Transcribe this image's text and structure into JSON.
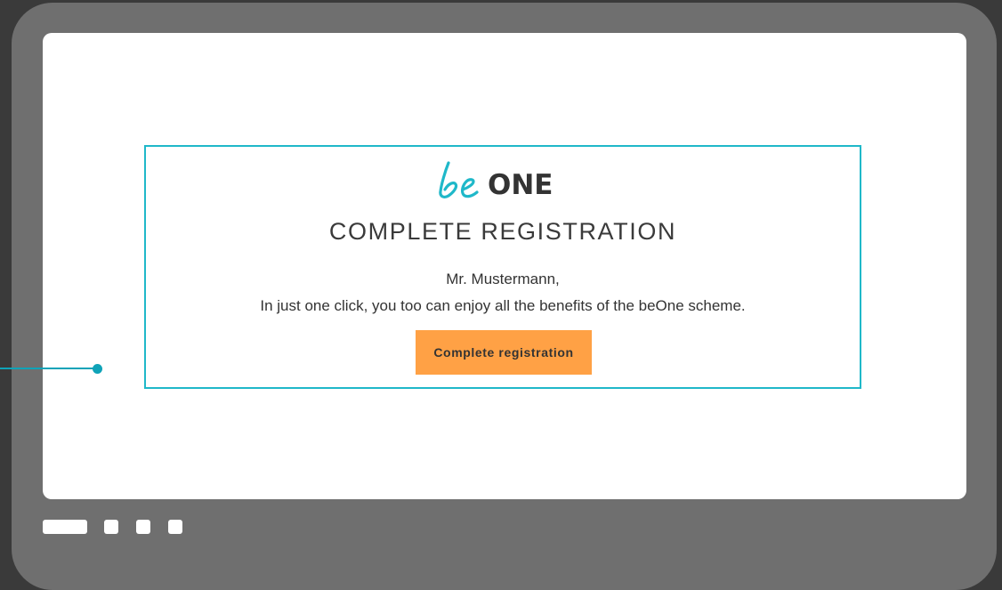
{
  "brand": {
    "logo_script": "be",
    "logo_word": "ONE",
    "accent_color": "#1fb8c9",
    "button_color": "#ffa145",
    "callout_color": "#0fa3b8"
  },
  "email": {
    "title": "COMPLETE REGISTRATION",
    "salutation": "Mr. Mustermann,",
    "body": "In just one click, you too can enjoy all the benefits of the beOne scheme.",
    "cta_label": "Complete registration"
  },
  "device": {
    "icons": [
      "home-pill-icon",
      "square-icon",
      "square-icon",
      "square-icon"
    ]
  }
}
